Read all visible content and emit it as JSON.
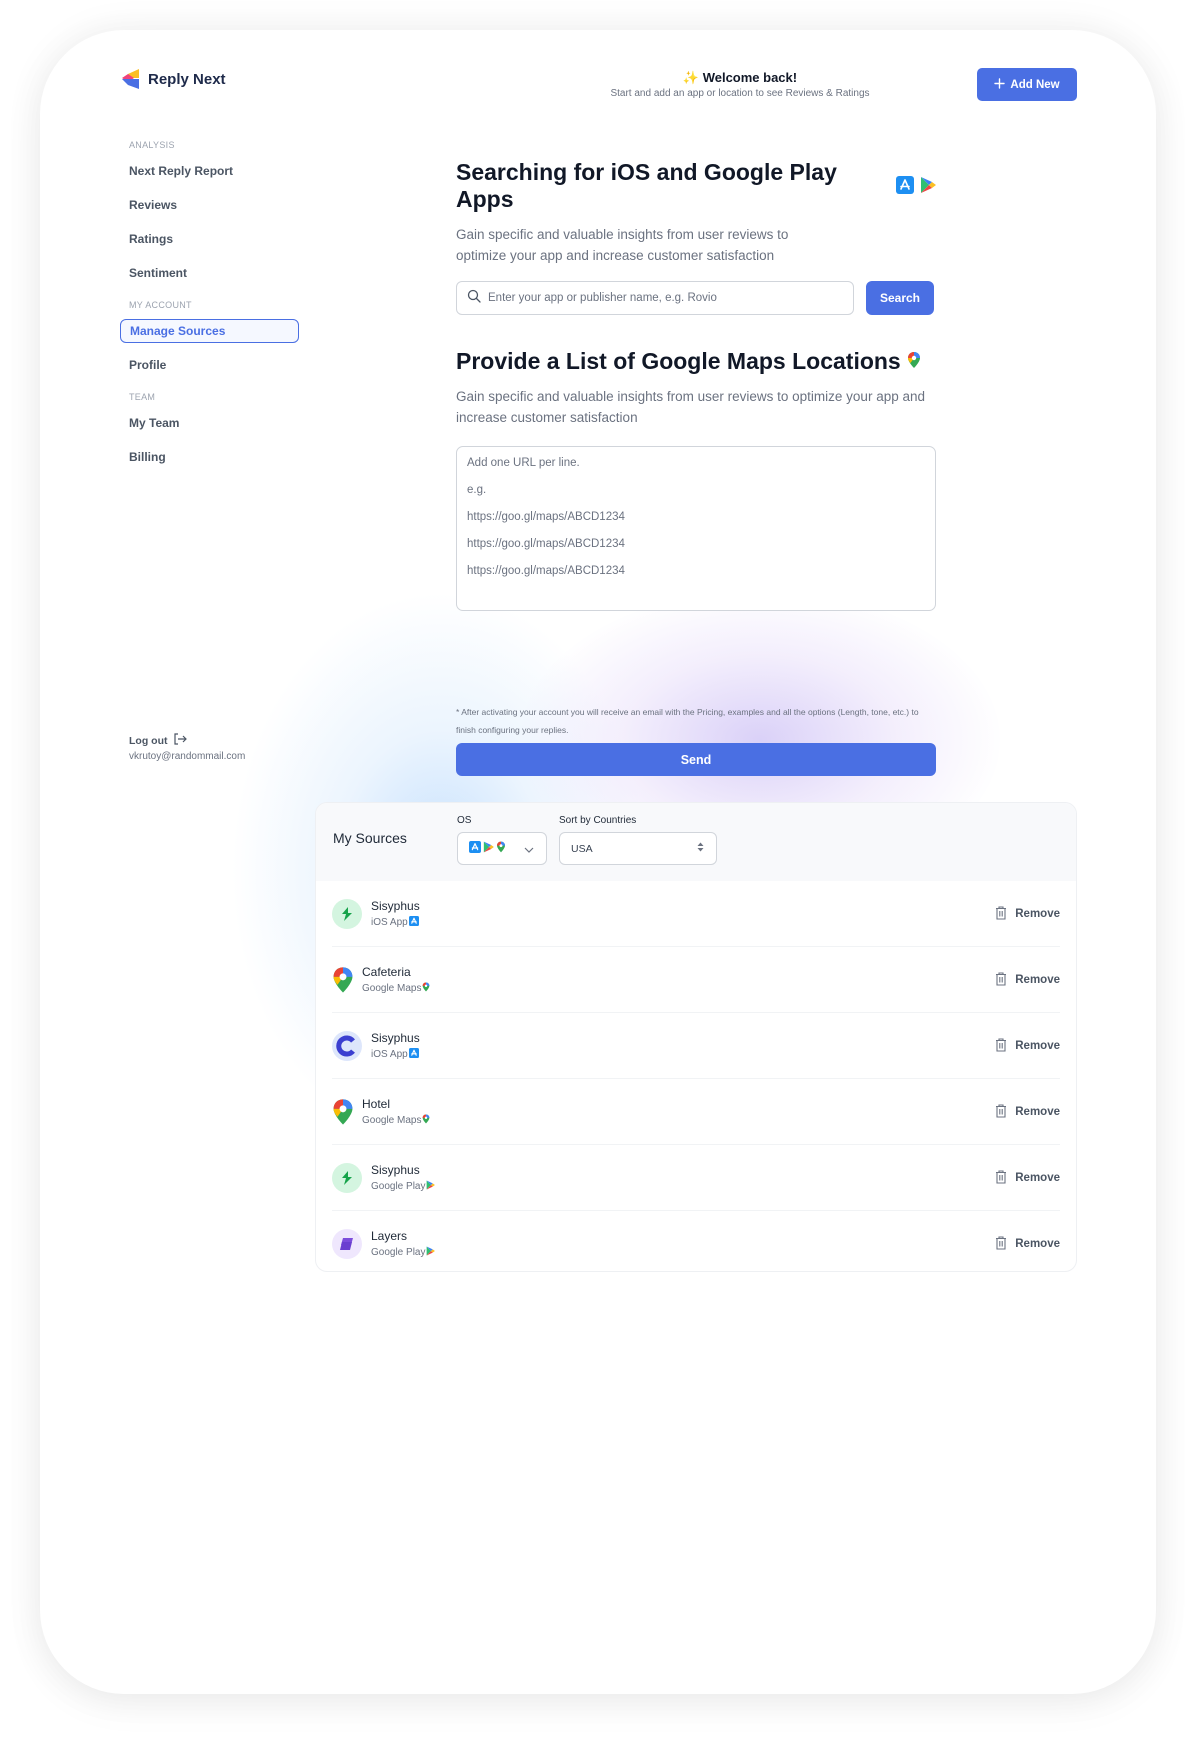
{
  "app": {
    "name": "Reply Next"
  },
  "header": {
    "welcome_title": "Welcome back!",
    "welcome_subtitle": "Start and add an app or location to see Reviews & Ratings",
    "add_new_label": "Add New"
  },
  "sidebar": {
    "sections": [
      {
        "label": "ANALYSIS",
        "items": [
          {
            "label": "Next Reply Report",
            "active": false
          },
          {
            "label": "Reviews",
            "active": false
          },
          {
            "label": "Ratings",
            "active": false
          },
          {
            "label": "Sentiment",
            "active": false
          }
        ]
      },
      {
        "label": "MY ACCOUNT",
        "items": [
          {
            "label": "Manage Sources",
            "active": true
          },
          {
            "label": "Profile",
            "active": false
          }
        ]
      },
      {
        "label": "TEAM",
        "items": [
          {
            "label": "My Team",
            "active": false
          },
          {
            "label": "Billing",
            "active": false
          }
        ]
      }
    ],
    "logout_label": "Log out",
    "user_email": "vkrutoy@randommail.com"
  },
  "search_section": {
    "title": "Searching for iOS and Google Play Apps",
    "description": "Gain specific and valuable insights from user reviews to optimize your app and increase customer satisfaction",
    "search_placeholder": "Enter your app or publisher name, e.g. Rovio",
    "search_value": "",
    "search_button": "Search"
  },
  "maps_section": {
    "title": "Provide a List of Google Maps Locations",
    "description": "Gain specific and valuable insights from user reviews to optimize your app and increase customer satisfaction",
    "url_placeholder_lines": [
      "Add one URL per line.",
      "e.g.",
      "https://goo.gl/maps/ABCD1234",
      "https://goo.gl/maps/ABCD1234",
      "https://goo.gl/maps/ABCD1234"
    ],
    "note": "* After activating your account you will receive an email with the Pricing, examples and all the options (Length, tone, etc.) to finish configuring your replies.",
    "send_button": "Send"
  },
  "sources": {
    "title": "My Sources",
    "os_label": "OS",
    "os_selected_icons": [
      "app-store-icon",
      "google-play-icon",
      "google-maps-icon"
    ],
    "country_label": "Sort by Countries",
    "country_selected": "USA",
    "remove_label": "Remove",
    "items": [
      {
        "name": "Sisyphus",
        "type": "iOS App",
        "platform": "app-store",
        "avatar": "sisyphus-green"
      },
      {
        "name": "Cafeteria",
        "type": "Google Maps",
        "platform": "google-maps",
        "avatar": "maps-pin"
      },
      {
        "name": "Sisyphus",
        "type": "iOS App",
        "platform": "app-store",
        "avatar": "sisyphus-blue"
      },
      {
        "name": "Hotel",
        "type": "Google Maps",
        "platform": "google-maps",
        "avatar": "maps-pin"
      },
      {
        "name": "Sisyphus",
        "type": "Google Play",
        "platform": "google-play",
        "avatar": "sisyphus-green"
      },
      {
        "name": "Layers",
        "type": "Google Play",
        "platform": "google-play",
        "avatar": "layers-purple"
      }
    ]
  },
  "colors": {
    "accent": "#4a6fe3",
    "text_primary": "#111827",
    "text_muted": "#6b7280",
    "border": "#d1d5db"
  }
}
